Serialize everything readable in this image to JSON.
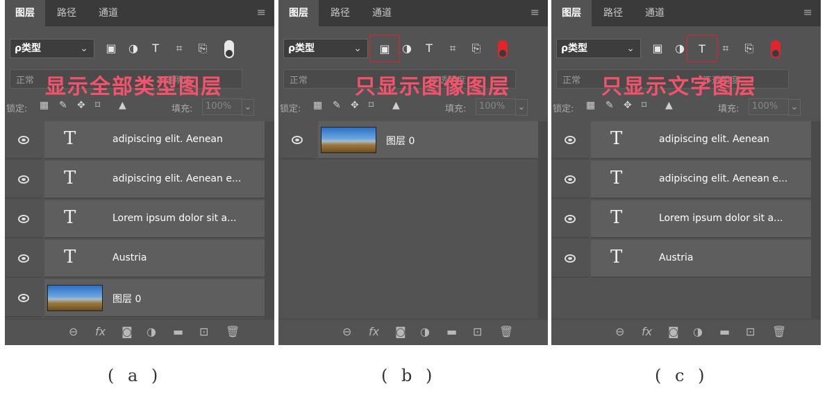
{
  "tabs": [
    "图层",
    "路径",
    "通道"
  ],
  "filter": {
    "label": "ρ类型",
    "chevron": "⌄"
  },
  "filter_icons": [
    "image-filter-icon",
    "adjustment-filter-icon",
    "type-filter-icon",
    "shape-filter-icon",
    "smart-object-filter-icon"
  ],
  "filter_glyphs": {
    "image": "▣",
    "adjust": "◑",
    "type": "T",
    "shape": "⌗",
    "smart": "⎘"
  },
  "blend": {
    "mode": "正常",
    "opacity_ghost": "不透明度"
  },
  "lock": {
    "label": "锁定:",
    "fill_label": "填充:",
    "fill_value": "100%"
  },
  "panels": [
    {
      "overlay": "显示全部类型图层",
      "active_filter": null,
      "toggle_on": false,
      "caption": "( a )",
      "layers": [
        {
          "kind": "type",
          "name": "adipiscing elit. Aenean"
        },
        {
          "kind": "type",
          "name": "adipiscing elit. Aenean e..."
        },
        {
          "kind": "type",
          "name": "Lorem ipsum dolor sit a..."
        },
        {
          "kind": "type",
          "name": "Austria"
        },
        {
          "kind": "image",
          "name": "图层 0"
        }
      ]
    },
    {
      "overlay": "只显示图像图层",
      "active_filter": "image",
      "toggle_on": true,
      "caption": "( b )",
      "layers": [
        {
          "kind": "image",
          "name": "图层 0"
        }
      ]
    },
    {
      "overlay": "只显示文字图层",
      "active_filter": "type",
      "toggle_on": true,
      "caption": "( c )",
      "layers": [
        {
          "kind": "type",
          "name": "adipiscing elit. Aenean"
        },
        {
          "kind": "type",
          "name": "adipiscing elit. Aenean e..."
        },
        {
          "kind": "type",
          "name": "Lorem ipsum dolor sit a..."
        },
        {
          "kind": "type",
          "name": "Austria"
        }
      ]
    }
  ],
  "type_glyph": "T",
  "footer_icons": [
    "link-icon",
    "fx-icon",
    "mask-icon",
    "adjustment-icon",
    "folder-icon",
    "new-layer-icon",
    "trash-icon"
  ],
  "footer_glyphs": {
    "link": "⊖",
    "fx": "fx",
    "mask": "◙",
    "adjust": "◑",
    "folder": "▬",
    "new": "⊡",
    "trash": "🗑"
  },
  "colors": {
    "panel": "#535353",
    "tabbar": "#3a3a3a",
    "row": "#5e5e5e",
    "overlay_text": "#f4536b",
    "highlight": "#e0222f",
    "toggle_on": "#e2242b"
  }
}
